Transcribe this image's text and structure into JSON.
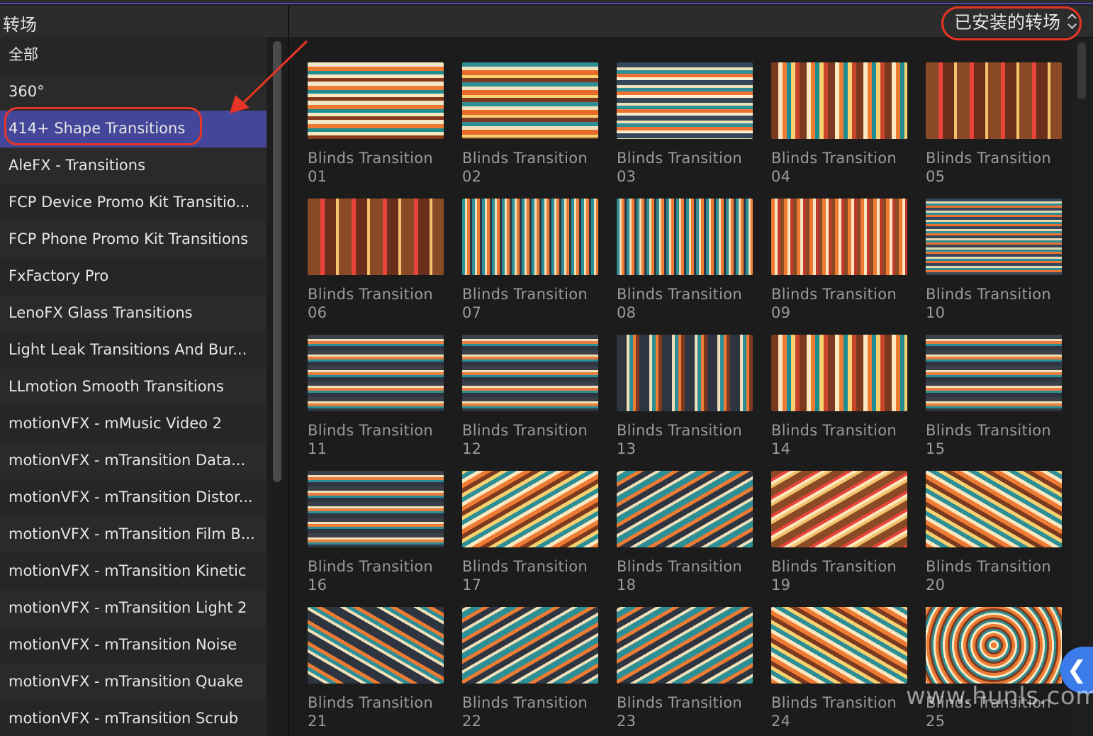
{
  "left_panel": {
    "title": "转场",
    "items": [
      {
        "label": "全部",
        "selected": false
      },
      {
        "label": "360°",
        "selected": false
      },
      {
        "label": "414+ Shape Transitions",
        "selected": true
      },
      {
        "label": "AleFX - Transitions",
        "selected": false
      },
      {
        "label": "FCP Device Promo Kit Transitio...",
        "selected": false
      },
      {
        "label": "FCP Phone Promo Kit Transitions",
        "selected": false
      },
      {
        "label": "FxFactory Pro",
        "selected": false
      },
      {
        "label": "LenoFX Glass Transitions",
        "selected": false
      },
      {
        "label": "Light Leak Transitions And Bur...",
        "selected": false
      },
      {
        "label": "LLmotion Smooth Transitions",
        "selected": false
      },
      {
        "label": "motionVFX - mMusic Video 2",
        "selected": false
      },
      {
        "label": "motionVFX - mTransition Data...",
        "selected": false
      },
      {
        "label": "motionVFX - mTransition Distor...",
        "selected": false
      },
      {
        "label": "motionVFX - mTransition Film B...",
        "selected": false
      },
      {
        "label": "motionVFX - mTransition Kinetic",
        "selected": false
      },
      {
        "label": "motionVFX - mTransition Light 2",
        "selected": false
      },
      {
        "label": "motionVFX - mTransition Noise",
        "selected": false
      },
      {
        "label": "motionVFX - mTransition Quake",
        "selected": false
      },
      {
        "label": "motionVFX - mTransition Scrub",
        "selected": false
      }
    ]
  },
  "right_panel": {
    "filter_label": "已安装的转场",
    "transitions": [
      {
        "name": "Blinds Transition",
        "number": "01"
      },
      {
        "name": "Blinds Transition",
        "number": "02"
      },
      {
        "name": "Blinds Transition",
        "number": "03"
      },
      {
        "name": "Blinds Transition",
        "number": "04"
      },
      {
        "name": "Blinds Transition",
        "number": "05"
      },
      {
        "name": "Blinds Transition",
        "number": "06"
      },
      {
        "name": "Blinds Transition",
        "number": "07"
      },
      {
        "name": "Blinds Transition",
        "number": "08"
      },
      {
        "name": "Blinds Transition",
        "number": "09"
      },
      {
        "name": "Blinds Transition",
        "number": "10"
      },
      {
        "name": "Blinds Transition",
        "number": "11"
      },
      {
        "name": "Blinds Transition",
        "number": "12"
      },
      {
        "name": "Blinds Transition",
        "number": "13"
      },
      {
        "name": "Blinds Transition",
        "number": "14"
      },
      {
        "name": "Blinds Transition",
        "number": "15"
      },
      {
        "name": "Blinds Transition",
        "number": "16"
      },
      {
        "name": "Blinds Transition",
        "number": "17"
      },
      {
        "name": "Blinds Transition",
        "number": "18"
      },
      {
        "name": "Blinds Transition",
        "number": "19"
      },
      {
        "name": "Blinds Transition",
        "number": "20"
      },
      {
        "name": "Blinds Transition",
        "number": "21"
      },
      {
        "name": "Blinds Transition",
        "number": "22"
      },
      {
        "name": "Blinds Transition",
        "number": "23"
      },
      {
        "name": "Blinds Transition",
        "number": "24"
      },
      {
        "name": "Blinds Transition",
        "number": "25"
      }
    ]
  },
  "watermark": "www.hunls.com",
  "collapse_button": {
    "icon": "chevron-left-icon",
    "glyph": "❮"
  },
  "colors": {
    "selection": "#44469a",
    "annotation_red": "#e63525",
    "accent_blue": "#3b7bea"
  }
}
